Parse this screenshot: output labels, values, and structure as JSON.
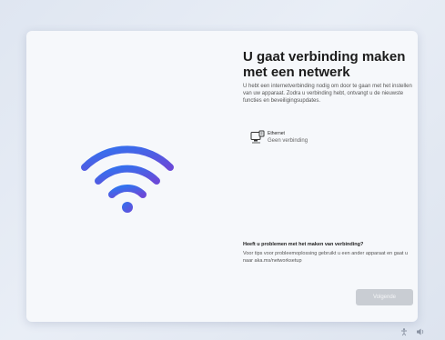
{
  "title": "U gaat verbinding maken met een netwerk",
  "description": "U hebt een internetverbinding nodig om door te gaan met het instellen van uw apparaat. Zodra u verbinding hebt, ontvangt u de nieuwste functies en beveiligingsupdates.",
  "network": {
    "name": "Ethernet",
    "status": "Geen verbinding",
    "icon": "ethernet-icon"
  },
  "help": {
    "title": "Heeft u problemen met het maken van verbinding?",
    "text": "Voor tips voor probleemoplossing gebruikt u een ander apparaat en gaat u naar aka.ms/networksetup"
  },
  "buttons": {
    "next_label": "Volgende"
  },
  "colors": {
    "wifi_gradient_start": "#3a6df0",
    "wifi_gradient_end": "#7b4fd6",
    "button_disabled": "#c9cdd3"
  },
  "tray_icons": [
    "accessibility-icon",
    "volume-icon"
  ]
}
